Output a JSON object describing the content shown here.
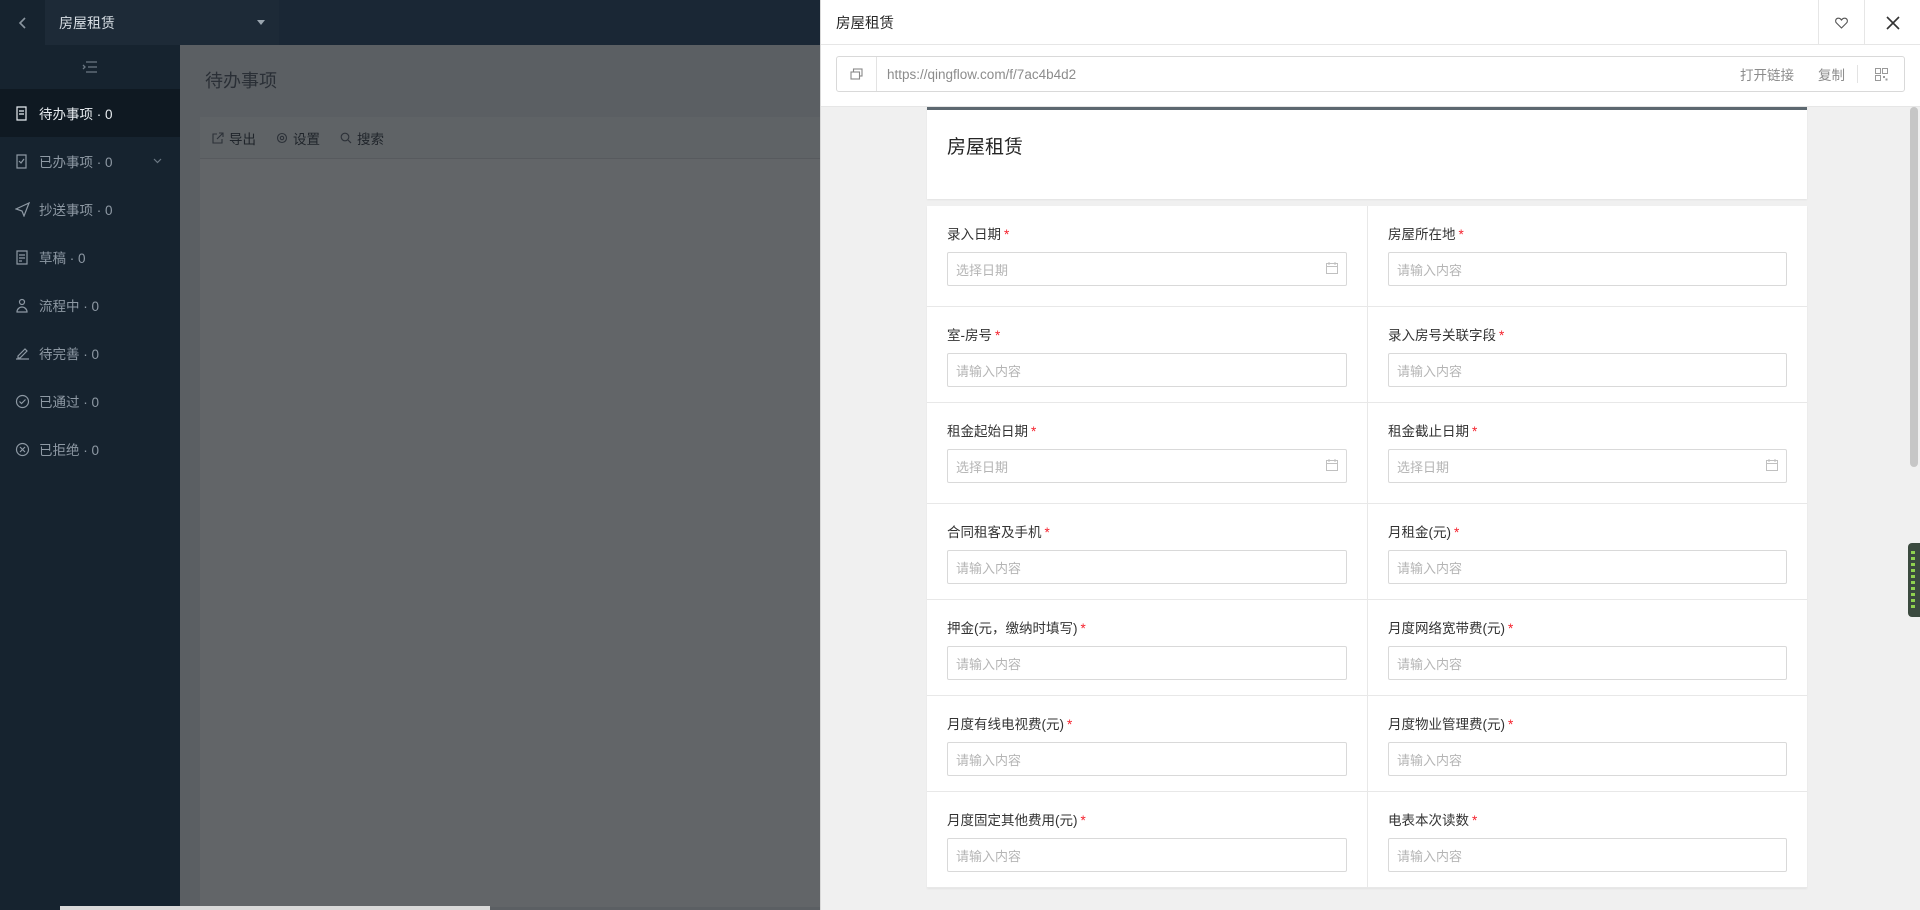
{
  "app": {
    "back_icon": "chevron-left-icon",
    "app_name": "房屋租赁",
    "dropdown_icon": "caret-down-icon",
    "collapse_icon": "menu-collapse-icon"
  },
  "sidebar": {
    "items": [
      {
        "label": "待办事项 · 0",
        "icon": "todo-icon",
        "active": true
      },
      {
        "label": "已办事项 · 0",
        "icon": "done-icon",
        "has_chevron": true
      },
      {
        "label": "抄送事项 · 0",
        "icon": "send-icon"
      },
      {
        "label": "草稿 · 0",
        "icon": "draft-icon"
      },
      {
        "label": "流程中 · 0",
        "icon": "flow-icon"
      },
      {
        "label": "待完善 · 0",
        "icon": "edit-icon"
      },
      {
        "label": "已通过 · 0",
        "icon": "check-circle-icon"
      },
      {
        "label": "已拒绝 · 0",
        "icon": "x-circle-icon"
      }
    ]
  },
  "main": {
    "title": "待办事项",
    "toolbar": {
      "export_label": "导出",
      "settings_label": "设置",
      "search_label": "搜索"
    }
  },
  "drawer": {
    "title": "房屋租赁",
    "link": {
      "url": "https://qingflow.com/f/7ac4b4d2",
      "open_label": "打开链接",
      "copy_label": "复制"
    },
    "form": {
      "title": "房屋租赁",
      "fields": [
        {
          "label": "录入日期",
          "placeholder": "选择日期",
          "type": "date"
        },
        {
          "label": "房屋所在地",
          "placeholder": "请输入内容",
          "type": "text"
        },
        {
          "label": "室-房号",
          "placeholder": "请输入内容",
          "type": "text"
        },
        {
          "label": "录入房号关联字段",
          "placeholder": "请输入内容",
          "type": "text"
        },
        {
          "label": "租金起始日期",
          "placeholder": "选择日期",
          "type": "date"
        },
        {
          "label": "租金截止日期",
          "placeholder": "选择日期",
          "type": "date"
        },
        {
          "label": "合同租客及手机",
          "placeholder": "请输入内容",
          "type": "text"
        },
        {
          "label": "月租金(元)",
          "placeholder": "请输入内容",
          "type": "text"
        },
        {
          "label": "押金(元，缴纳时填写)",
          "placeholder": "请输入内容",
          "type": "text"
        },
        {
          "label": "月度网络宽带费(元)",
          "placeholder": "请输入内容",
          "type": "text"
        },
        {
          "label": "月度有线电视费(元)",
          "placeholder": "请输入内容",
          "type": "text"
        },
        {
          "label": "月度物业管理费(元)",
          "placeholder": "请输入内容",
          "type": "text"
        },
        {
          "label": "月度固定其他费用(元)",
          "placeholder": "请输入内容",
          "type": "text"
        },
        {
          "label": "电表本次读数",
          "placeholder": "请输入内容",
          "type": "text"
        }
      ],
      "required_mark": "*"
    }
  }
}
